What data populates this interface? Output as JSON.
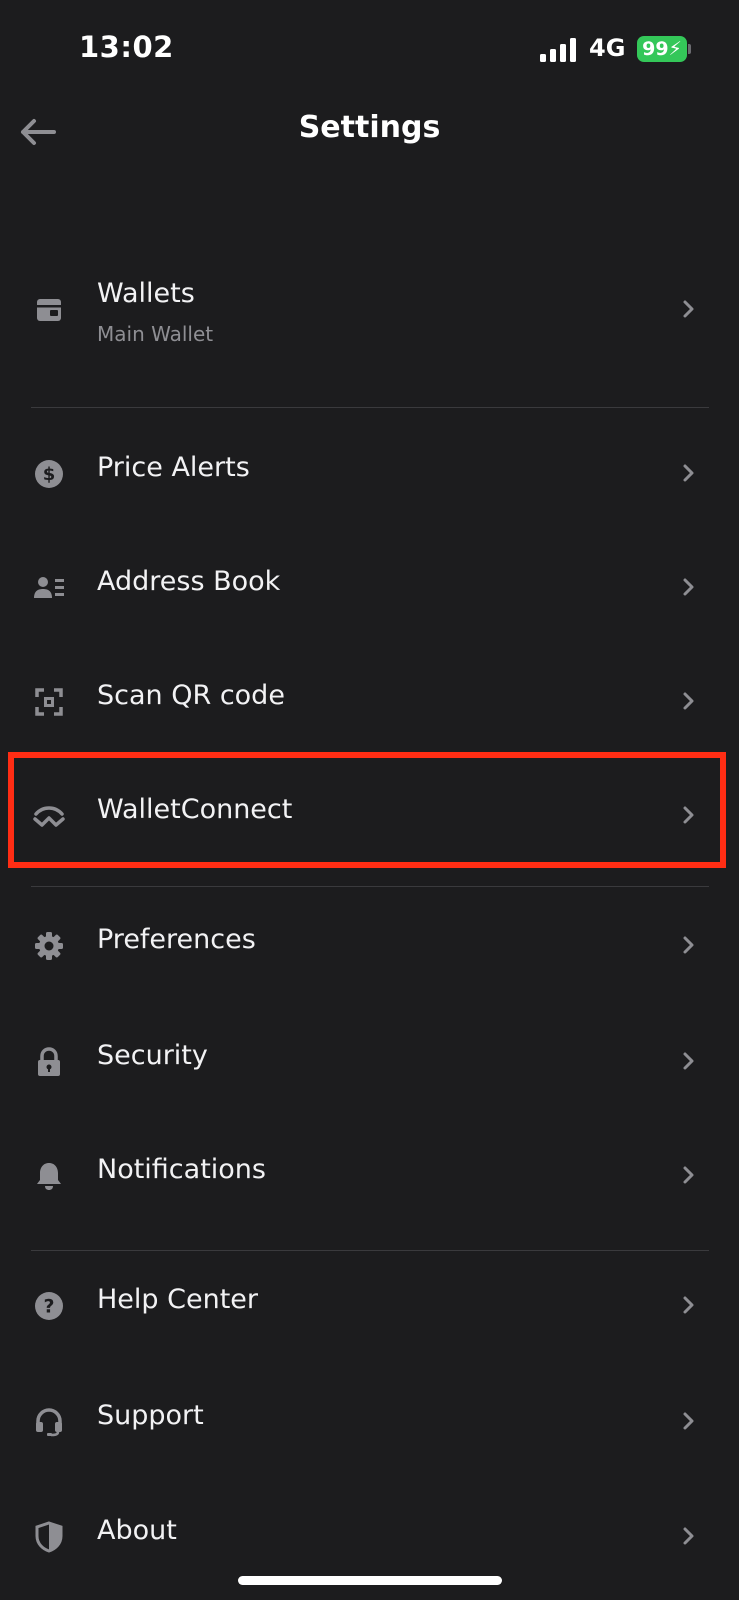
{
  "status_bar": {
    "time": "13:02",
    "network": "4G",
    "battery": "99"
  },
  "header": {
    "title": "Settings",
    "back_icon": "arrow-left-icon"
  },
  "colors": {
    "background": "#1c1c1e",
    "text": "#f2f2f4",
    "secondary_text": "#8e8e93",
    "icon": "#8e8e93",
    "divider": "#3a3a3d",
    "battery": "#34c759",
    "highlight": "#ff2d14"
  },
  "settings": {
    "items": [
      {
        "label": "Wallets",
        "subtitle": "Main Wallet",
        "icon": "wallet-icon"
      },
      {
        "label": "Price Alerts",
        "icon": "dollar-circle-icon"
      },
      {
        "label": "Address Book",
        "icon": "address-book-icon"
      },
      {
        "label": "Scan QR code",
        "icon": "scan-qr-icon"
      },
      {
        "label": "WalletConnect",
        "icon": "walletconnect-icon",
        "highlighted": true
      },
      {
        "label": "Preferences",
        "icon": "gear-icon"
      },
      {
        "label": "Security",
        "icon": "lock-icon"
      },
      {
        "label": "Notifications",
        "icon": "bell-icon"
      },
      {
        "label": "Help Center",
        "icon": "help-circle-icon"
      },
      {
        "label": "Support",
        "icon": "headset-icon"
      },
      {
        "label": "About",
        "icon": "shield-icon"
      }
    ]
  }
}
